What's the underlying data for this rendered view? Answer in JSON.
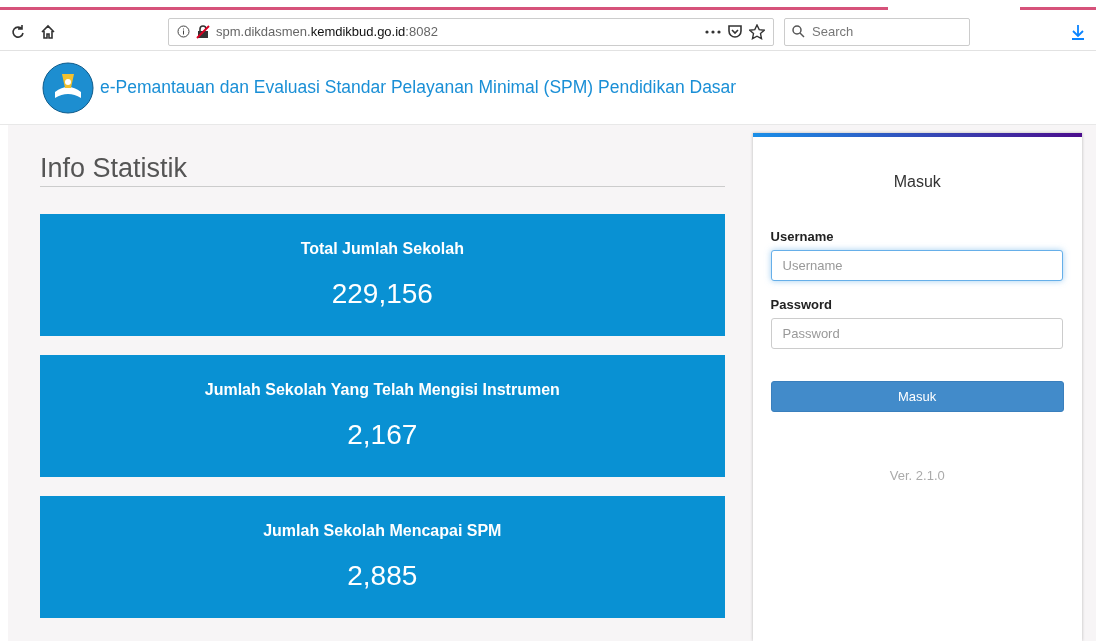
{
  "browser": {
    "url": "spm.dikdasmen.**kemdikbud.go.id**:8082",
    "search": {
      "placeholder": "Search"
    }
  },
  "header": {
    "title": "e-Pemantauan dan Evaluasi Standar Pelayanan Minimal (SPM) Pendidikan Dasar"
  },
  "info": {
    "heading": "Info Statistik",
    "cards": [
      {
        "label": "Total Jumlah Sekolah",
        "value": "229,156"
      },
      {
        "label": "Jumlah Sekolah Yang Telah Mengisi Instrumen",
        "value": "2,167"
      },
      {
        "label": "Jumlah Sekolah Mencapai SPM",
        "value": "2,885"
      }
    ]
  },
  "login": {
    "title": "Masuk",
    "fields": [
      {
        "label": "Username",
        "placeholder": "Username",
        "focused": true
      },
      {
        "label": "Password",
        "placeholder": "Password",
        "focused": false
      }
    ],
    "button": "Masuk",
    "version": "Ver. 2.1.0"
  }
}
